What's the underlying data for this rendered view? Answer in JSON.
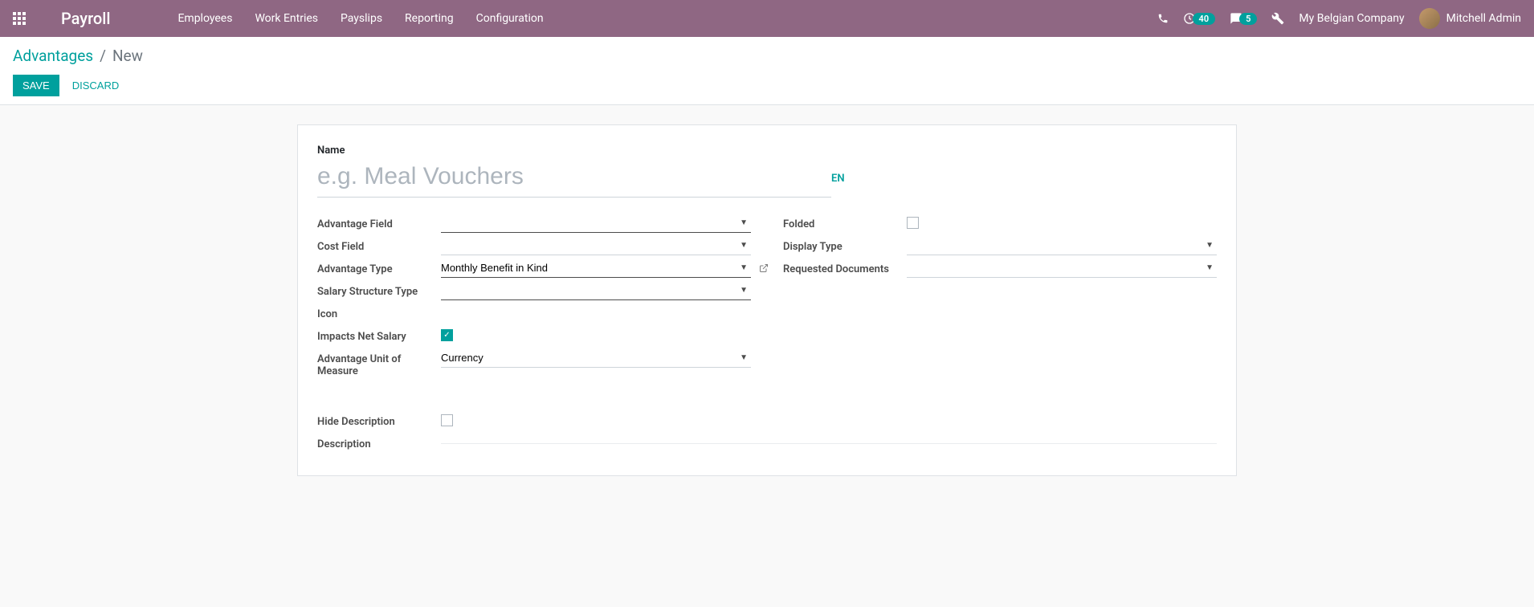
{
  "navbar": {
    "brand": "Payroll",
    "menu": [
      "Employees",
      "Work Entries",
      "Payslips",
      "Reporting",
      "Configuration"
    ],
    "activity_count": "40",
    "message_count": "5",
    "company": "My Belgian Company",
    "user": "Mitchell Admin"
  },
  "breadcrumb": {
    "parent": "Advantages",
    "current": "New"
  },
  "buttons": {
    "save": "Save",
    "discard": "Discard"
  },
  "form": {
    "name_label": "Name",
    "name_placeholder": "e.g. Meal Vouchers",
    "lang": "EN",
    "left_fields": {
      "advantage_field": "Advantage Field",
      "cost_field": "Cost Field",
      "advantage_type": "Advantage Type",
      "advantage_type_value": "Monthly Benefit in Kind",
      "salary_structure_type": "Salary Structure Type",
      "icon": "Icon",
      "impacts_net_salary": "Impacts Net Salary",
      "advantage_uom": "Advantage Unit of Measure",
      "advantage_uom_value": "Currency"
    },
    "right_fields": {
      "folded": "Folded",
      "display_type": "Display Type",
      "requested_documents": "Requested Documents"
    },
    "desc_fields": {
      "hide_description": "Hide Description",
      "description": "Description"
    }
  }
}
